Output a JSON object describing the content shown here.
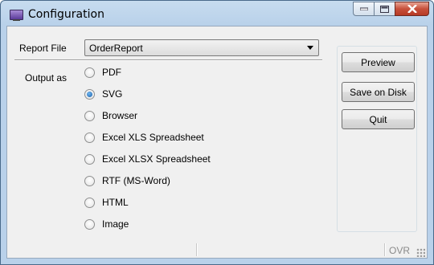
{
  "window": {
    "title": "Configuration"
  },
  "form": {
    "report_file_label": "Report File",
    "report_file_value": "OrderReport",
    "output_as_label": "Output as"
  },
  "output_options": [
    {
      "label": "PDF",
      "checked": false
    },
    {
      "label": "SVG",
      "checked": true
    },
    {
      "label": "Browser",
      "checked": false
    },
    {
      "label": "Excel XLS Spreadsheet",
      "checked": false
    },
    {
      "label": "Excel XLSX Spreadsheet",
      "checked": false
    },
    {
      "label": "RTF (MS-Word)",
      "checked": false
    },
    {
      "label": "HTML",
      "checked": false
    },
    {
      "label": "Image",
      "checked": false
    }
  ],
  "buttons": {
    "preview": "Preview",
    "save_on_disk": "Save on Disk",
    "quit": "Quit"
  },
  "statusbar": {
    "mode": "OVR"
  },
  "icons": {
    "app": "app-window-icon",
    "minimize": "minimize-icon",
    "maximize": "maximize-icon",
    "close": "close-icon",
    "dropdown": "chevron-down-icon",
    "grip": "resize-grip-icon"
  }
}
